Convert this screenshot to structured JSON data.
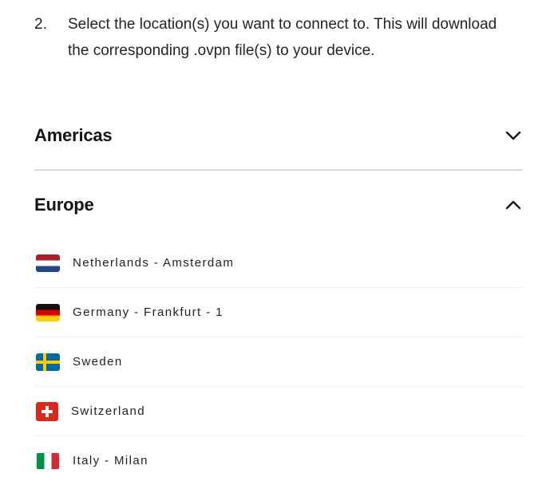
{
  "step": {
    "number": "2.",
    "text": "Select the location(s) you want to connect to. This will download the corresponding .ovpn file(s) to your device."
  },
  "regions": [
    {
      "title": "Americas",
      "expanded": false,
      "icon": "chevron-down-icon"
    },
    {
      "title": "Europe",
      "expanded": true,
      "icon": "chevron-up-icon"
    }
  ],
  "europe_locations": [
    {
      "label": "Netherlands - Amsterdam",
      "flag": "netherlands-flag-icon"
    },
    {
      "label": "Germany - Frankfurt - 1",
      "flag": "germany-flag-icon"
    },
    {
      "label": "Sweden",
      "flag": "sweden-flag-icon"
    },
    {
      "label": "Switzerland",
      "flag": "switzerland-flag-icon"
    },
    {
      "label": "Italy - Milan",
      "flag": "italy-flag-icon"
    }
  ],
  "colors": {
    "text": "#1f2328",
    "heading": "#121417",
    "divider": "#d7d9dc"
  }
}
